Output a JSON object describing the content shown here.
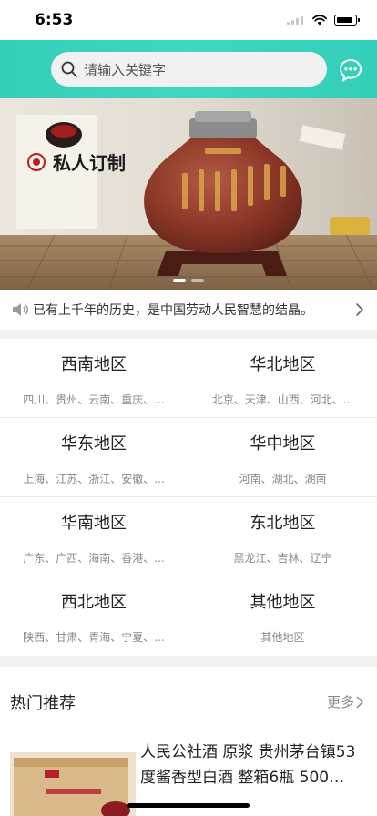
{
  "status_bar": {
    "time": "6:53"
  },
  "search": {
    "placeholder": "请输入关键字"
  },
  "banner": {
    "brand_text": "私人订制",
    "slide_count": 2,
    "active_slide": 1
  },
  "notice": {
    "text": "已有上千年的历史，是中国劳动人民智慧的结晶。"
  },
  "regions": [
    {
      "name": "西南地区",
      "provinces": "四川、贵州、云南、重庆、..."
    },
    {
      "name": "华北地区",
      "provinces": "北京、天津、山西、河北、..."
    },
    {
      "name": "华东地区",
      "provinces": "上海、江苏、浙江、安徽、..."
    },
    {
      "name": "华中地区",
      "provinces": "河南、湖北、湖南"
    },
    {
      "name": "华南地区",
      "provinces": "广东、广西、海南、香港、..."
    },
    {
      "name": "东北地区",
      "provinces": "黑龙江、吉林、辽宁"
    },
    {
      "name": "西北地区",
      "provinces": "陕西、甘肃、青海、宁夏、..."
    },
    {
      "name": "其他地区",
      "provinces": "其他地区"
    }
  ],
  "hot": {
    "title": "热门推荐",
    "more_label": "更多",
    "products": [
      {
        "title": "人民公社酒 原浆 贵州茅台镇53度酱香型白酒 整箱6瓶 500…"
      }
    ]
  },
  "colors": {
    "header": "#3fd6c2",
    "accent": "#34cfb8"
  },
  "icons": [
    "search-icon",
    "chat-icon",
    "speaker-icon",
    "chevron-right-icon"
  ]
}
